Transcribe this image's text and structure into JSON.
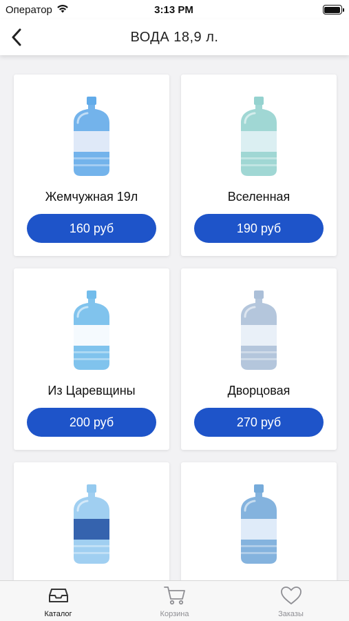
{
  "status_bar": {
    "carrier": "Оператор",
    "time": "3:13 PM"
  },
  "nav": {
    "title": "ВОДА 18,9 л."
  },
  "products": [
    {
      "name": "Жемчужная 19л",
      "price": "160 руб",
      "icon": "water-bottle-icon",
      "bottle_color": "#5aa6e8",
      "label_color": "#e8eef8"
    },
    {
      "name": "Вселенная",
      "price": "190 руб",
      "icon": "water-bottle-icon",
      "bottle_color": "#8fd0cc",
      "label_color": "#dff1f4"
    },
    {
      "name": "Из Царевщины",
      "price": "200 руб",
      "icon": "water-bottle-icon",
      "bottle_color": "#6ab8ea",
      "label_color": "#ffffff"
    },
    {
      "name": "Дворцовая",
      "price": "270 руб",
      "icon": "water-bottle-icon",
      "bottle_color": "#a7bcd6",
      "label_color": "#eef3fa"
    },
    {
      "name": "",
      "price": "",
      "icon": "water-bottle-icon",
      "bottle_color": "#8fc7ee",
      "label_color": "#2b5aa8"
    },
    {
      "name": "",
      "price": "",
      "icon": "water-bottle-icon",
      "bottle_color": "#6fa6d8",
      "label_color": "#e7f0fb"
    }
  ],
  "tabs": [
    {
      "label": "Каталог",
      "icon": "catalog-tray-icon",
      "active": true
    },
    {
      "label": "Корзина",
      "icon": "cart-icon",
      "active": false
    },
    {
      "label": "Заказы",
      "icon": "heart-icon",
      "active": false
    }
  ],
  "colors": {
    "accent": "#1e54c9",
    "background": "#f2f2f4",
    "tab_inactive": "#8e8e93"
  }
}
